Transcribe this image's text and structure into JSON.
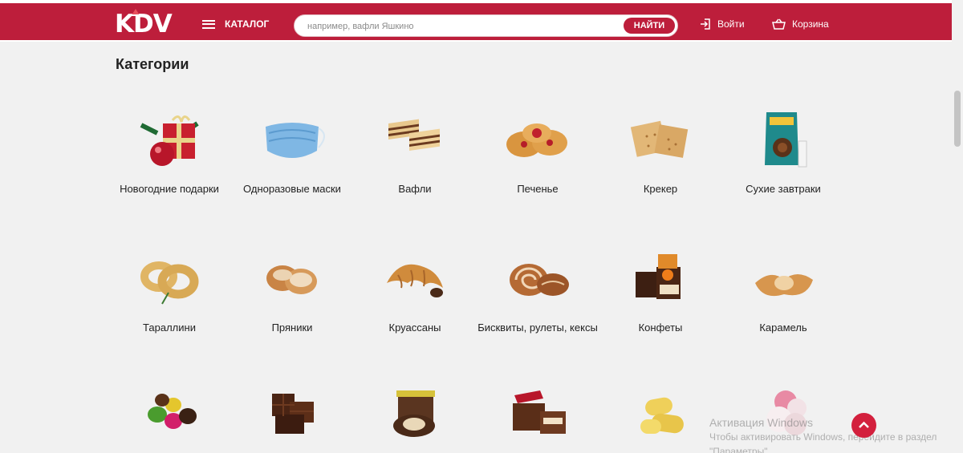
{
  "header": {
    "logo": "KDV",
    "catalog_label": "КАТАЛОГ",
    "search": {
      "placeholder": "например, вафли Яшкино",
      "button_label": "НАЙТИ"
    },
    "login_label": "Войти",
    "cart_label": "Корзина",
    "accent_color": "#bd1e3b"
  },
  "main": {
    "heading": "Категории",
    "categories": [
      {
        "label": "Новогодние подарки",
        "icon": "gift-box-icon"
      },
      {
        "label": "Одноразовые маски",
        "icon": "face-mask-icon"
      },
      {
        "label": "Вафли",
        "icon": "wafers-icon"
      },
      {
        "label": "Печенье",
        "icon": "cookies-icon"
      },
      {
        "label": "Крекер",
        "icon": "crackers-icon"
      },
      {
        "label": "Сухие завтраки",
        "icon": "cereal-pack-icon"
      },
      {
        "label": "Тараллини",
        "icon": "taralli-icon"
      },
      {
        "label": "Пряники",
        "icon": "gingerbread-icon"
      },
      {
        "label": "Круассаны",
        "icon": "croissant-icon"
      },
      {
        "label": "Бисквиты, рулеты, кексы",
        "icon": "swiss-roll-icon"
      },
      {
        "label": "Конфеты",
        "icon": "candy-icon"
      },
      {
        "label": "Карамель",
        "icon": "caramel-icon"
      },
      {
        "label": "",
        "icon": "dragee-icon"
      },
      {
        "label": "",
        "icon": "chocolate-icon"
      },
      {
        "label": "",
        "icon": "chocolate-paste-icon"
      },
      {
        "label": "",
        "icon": "cake-bar-icon"
      },
      {
        "label": "",
        "icon": "corn-sticks-icon"
      },
      {
        "label": "",
        "icon": "marshmallow-icon"
      }
    ]
  },
  "overlay": {
    "watermark_title": "Активация Windows",
    "watermark_text_1": "Чтобы активировать Windows, перейдите в раздел",
    "watermark_text_2": "\"Параметры\"."
  }
}
